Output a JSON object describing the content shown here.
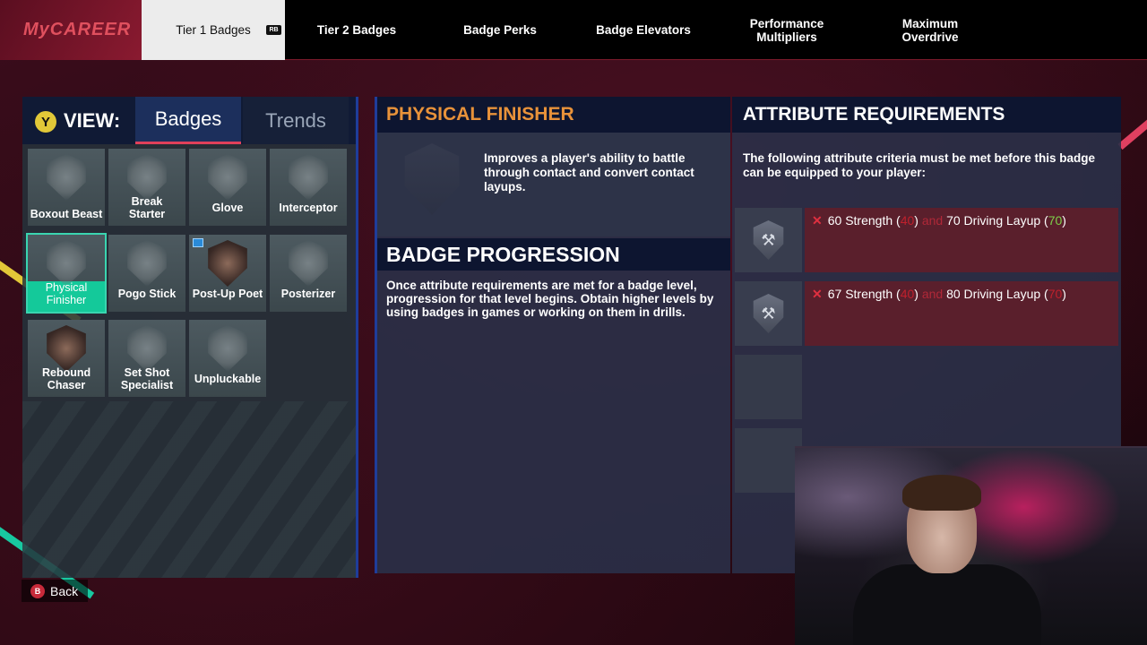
{
  "nav": {
    "brand": "MyCAREER",
    "tabs": [
      {
        "label": "Tier 1 Badges"
      },
      {
        "label": "Tier 2 Badges"
      },
      {
        "label": "Badge Perks"
      },
      {
        "label": "Badge Elevators"
      },
      {
        "label": "Performance Multipliers"
      },
      {
        "label": "Maximum Overdrive"
      }
    ],
    "rb_label": "RB"
  },
  "view": {
    "button": "Y",
    "label": "VIEW:",
    "tab_badges": "Badges",
    "tab_trends": "Trends"
  },
  "badges": [
    {
      "label": "Boxout Beast"
    },
    {
      "label": "Break Starter"
    },
    {
      "label": "Glove"
    },
    {
      "label": "Interceptor"
    },
    {
      "label": "Physical Finisher"
    },
    {
      "label": "Pogo Stick"
    },
    {
      "label": "Post-Up Poet"
    },
    {
      "label": "Posterizer"
    },
    {
      "label": "Rebound Chaser"
    },
    {
      "label": "Set Shot Specialist"
    },
    {
      "label": "Unpluckable"
    }
  ],
  "detail": {
    "title": "PHYSICAL FINISHER",
    "description": "Improves a player's ability to battle through contact and convert contact layups.",
    "progression_title": "BADGE PROGRESSION",
    "progression_text": "Once attribute requirements are met for a badge level, progression for that level begins. Obtain higher levels by using badges in games or working on them in drills."
  },
  "requirements": {
    "title": "ATTRIBUTE REQUIREMENTS",
    "intro": "The following attribute criteria must be met before this badge can be equipped to your player:",
    "and": "and",
    "rows": [
      {
        "req1": "60 Strength",
        "cur1": "40",
        "req2": "70 Driving Layup",
        "cur2": "70"
      },
      {
        "req1": "67 Strength",
        "cur1": "40",
        "req2": "80 Driving Layup",
        "cur2": "70"
      }
    ]
  },
  "back": {
    "button": "B",
    "label": "Back"
  },
  "colors": {
    "accent_orange": "#e8923a",
    "selected_green": "#14c99a",
    "fail_red": "#e03040"
  }
}
